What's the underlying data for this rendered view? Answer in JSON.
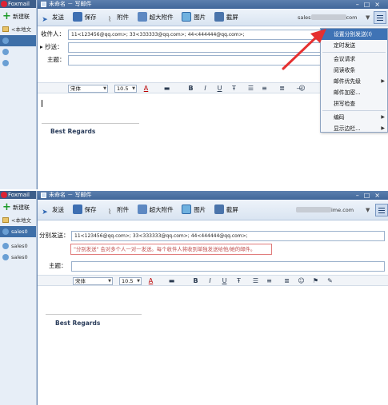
{
  "colors": {
    "accent": "#3f73b5",
    "annotation": "#e53030"
  },
  "foxmail": {
    "app_title": "Foxmail",
    "new_button": "新建联",
    "folder_label": "<本地文",
    "accounts_short": [
      "sales0",
      "sales0"
    ]
  },
  "compose": {
    "window_title": "未命名 － 写邮件",
    "toolbar": {
      "send": "发送",
      "save": "保存",
      "attach": "附件",
      "big_attach": "超大附件",
      "picture": "图片",
      "screenshot": "截屏"
    },
    "account_suffix_1": "sales",
    "account_suffix_1b": "com",
    "account_suffix_2": "ime.com",
    "to_label": "收件人：",
    "cc_label": "抄送：",
    "subject_label": "主题：",
    "separate_send_label": "分别发送：",
    "recipients": "11<123456@qq.com>; 33<333333@qq.com>; 44<444444@qq.com>;",
    "font_name": "宋体",
    "font_size": "10.5",
    "signature": "Best Regards",
    "hint": "\"分别发送\" 会对多个人一对一发送。每个收件人将收到单独发送给他/她的邮件。"
  },
  "options_menu": {
    "items": [
      {
        "label": "设置分别发送(I)",
        "highlighted": true,
        "has_submenu": false
      },
      {
        "label": "定时发送",
        "highlighted": false,
        "has_submenu": false
      },
      {
        "label": "会议请求",
        "highlighted": false,
        "has_submenu": false
      },
      {
        "label": "阅读收条",
        "highlighted": false,
        "has_submenu": false
      },
      {
        "label": "邮件优先级",
        "highlighted": false,
        "has_submenu": true
      },
      {
        "label": "邮件加密...",
        "highlighted": false,
        "has_submenu": false
      },
      {
        "label": "拼写检查",
        "highlighted": false,
        "has_submenu": false
      },
      {
        "label": "编码",
        "highlighted": false,
        "has_submenu": true
      },
      {
        "label": "显示边栏...",
        "highlighted": false,
        "has_submenu": true
      }
    ]
  }
}
